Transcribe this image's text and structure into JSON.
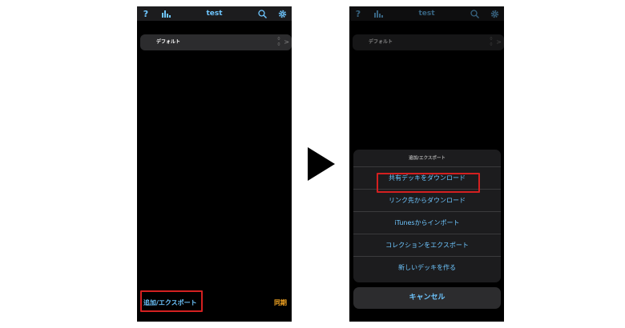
{
  "left_screen": {
    "title": "test",
    "icons": {
      "help": "?",
      "stats": "bar-chart-icon",
      "search": "search-icon",
      "settings": "gear-icon"
    },
    "deck": {
      "name": "デフォルト",
      "count_top": "0",
      "count_bottom": "0",
      "chevron": ">"
    },
    "add_export_label": "追加/エクスポート",
    "sync_label": "同期"
  },
  "right_screen": {
    "title": "test",
    "icons": {
      "help": "?",
      "stats": "bar-chart-icon",
      "search": "search-icon",
      "settings": "gear-icon"
    },
    "deck": {
      "name": "デフォルト",
      "count_top": "0",
      "count_bottom": "0",
      "chevron": ">"
    },
    "sheet": {
      "title": "追加/エクスポート",
      "options": [
        "共有デッキをダウンロード",
        "リンク先からダウンロード",
        "iTunesからインポート",
        "コレクションをエクスポート",
        "新しいデッキを作る"
      ],
      "cancel": "キャンセル"
    }
  },
  "colors": {
    "accent": "#6ec6ff",
    "sync": "#f5a623",
    "highlight": "#d42020"
  }
}
